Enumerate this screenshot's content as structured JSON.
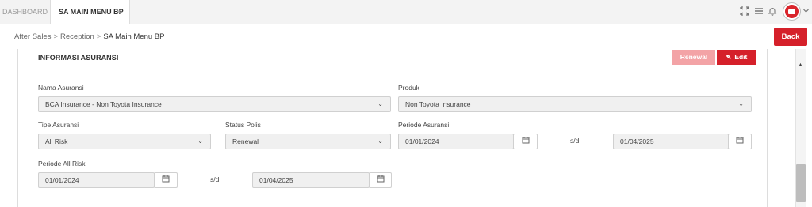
{
  "tabs": [
    {
      "label": "DASHBOARD",
      "active": false
    },
    {
      "label": "SA MAIN MENU BP",
      "active": true
    }
  ],
  "tab_close_glyph": "×",
  "header_icons": [
    "expand-icon",
    "menu-icon",
    "bell-icon",
    "avatar",
    "chevron-down-icon"
  ],
  "breadcrumb": {
    "items": [
      "After Sales",
      "Reception",
      "SA Main Menu BP"
    ],
    "separator": ">"
  },
  "back_label": "Back",
  "section": {
    "title": "INFORMASI ASURANSI",
    "renewal_label": "Renewal",
    "edit_label": "Edit"
  },
  "form": {
    "nama_asuransi": {
      "label": "Nama Asuransi",
      "value": "BCA Insurance - Non Toyota Insurance"
    },
    "produk": {
      "label": "Produk",
      "value": "Non Toyota Insurance"
    },
    "tipe_asuransi": {
      "label": "Tipe Asuransi",
      "value": "All Risk"
    },
    "status_polis": {
      "label": "Status Polis",
      "value": "Renewal"
    },
    "periode_asuransi": {
      "label": "Periode Asuransi",
      "from": "01/01/2024",
      "to": "01/04/2025"
    },
    "periode_all_risk": {
      "label": "Periode All Risk",
      "from": "01/01/2024",
      "to": "01/04/2025"
    },
    "range_separator": "s/d"
  },
  "colors": {
    "accent": "#d5202a",
    "accent_disabled": "#f3a3a6"
  }
}
